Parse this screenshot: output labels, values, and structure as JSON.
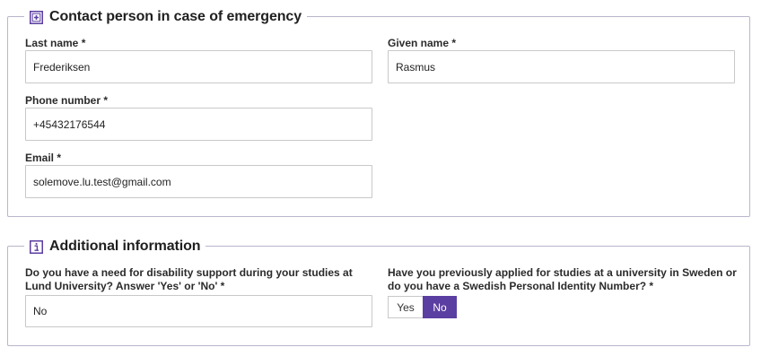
{
  "emergency": {
    "title": "Contact person in case of emergency",
    "icon": "first-aid-icon",
    "last_name_label": "Last name *",
    "last_name_value": "Frederiksen",
    "given_name_label": "Given name *",
    "given_name_value": "Rasmus",
    "phone_label": "Phone number *",
    "phone_value": "+45432176544",
    "email_label": "Email *",
    "email_value": "solemove.lu.test@gmail.com"
  },
  "additional": {
    "title": "Additional information",
    "icon": "info-icon",
    "disability_label": "Do you have a need for disability support during your studies at Lund University? Answer 'Yes' or 'No' *",
    "disability_value": "No",
    "previous_label": "Have you previously applied for studies at a university in Sweden or do you have a Swedish Personal Identity Number? *",
    "option_yes": "Yes",
    "option_no": "No",
    "selected": "No"
  },
  "colors": {
    "accent": "#5b3ea1",
    "border": "#b8b6cc"
  }
}
